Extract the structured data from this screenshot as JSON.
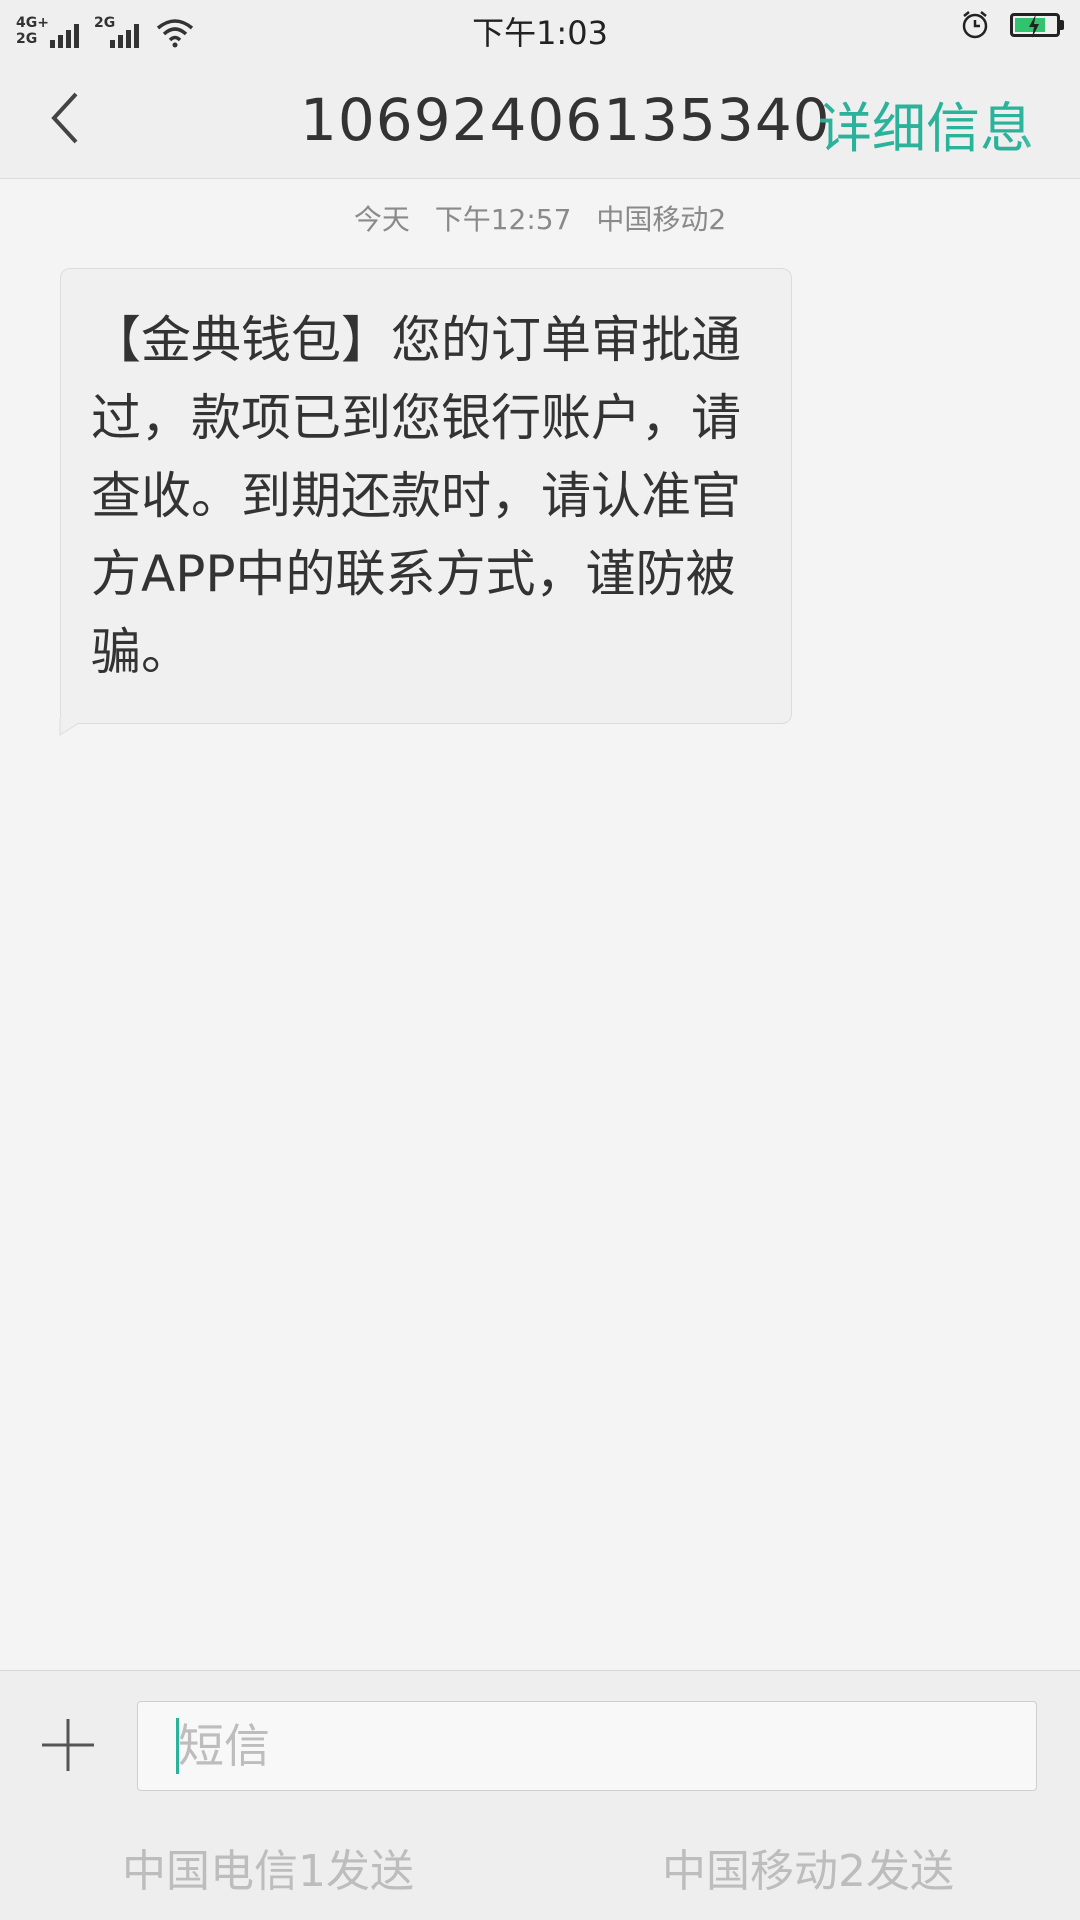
{
  "status_bar": {
    "network_1_top": "4G+",
    "network_1_bottom": "2G",
    "network_2": "2G",
    "time": "下午1:03",
    "battery_level": 0.75,
    "charging": true,
    "icons": [
      "signal-icon",
      "wifi-icon",
      "alarm-icon",
      "battery-icon"
    ]
  },
  "header": {
    "back_icon": "chevron-left-icon",
    "title": "10692406135340",
    "details_label": "详细信息"
  },
  "conversation": {
    "meta": {
      "day": "今天",
      "time": "下午12:57",
      "sim": "中国移动2"
    },
    "messages": [
      {
        "direction": "incoming",
        "text": "【金典钱包】您的订单审批通过，款项已到您银行账户，请查收。到期还款时，请认准官方APP中的联系方式，谨防被骗。"
      }
    ]
  },
  "compose": {
    "add_icon": "plus-icon",
    "placeholder": "短信",
    "send_sim1_label": "中国电信1发送",
    "send_sim2_label": "中国移动2发送"
  },
  "colors": {
    "accent": "#2ab39a",
    "battery": "#2fc46d"
  }
}
